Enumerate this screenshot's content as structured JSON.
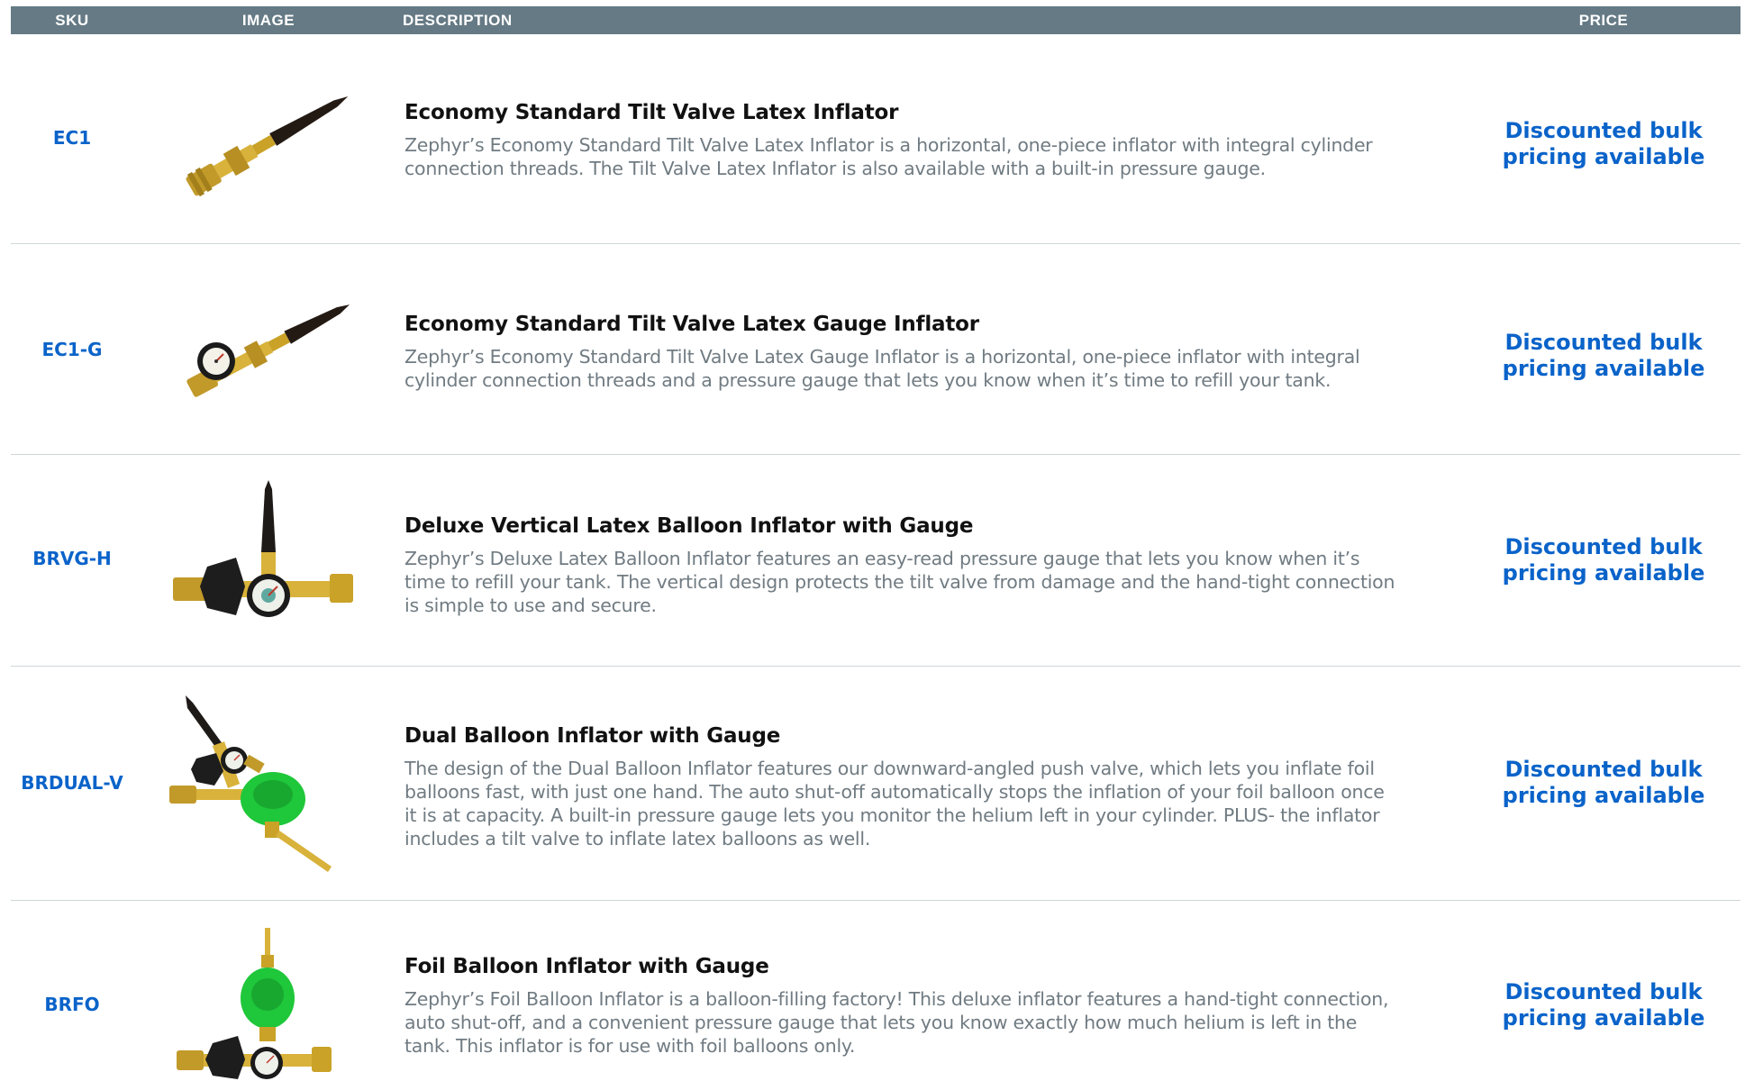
{
  "header": {
    "sku": "SKU",
    "image": "IMAGE",
    "description": "DESCRIPTION",
    "price": "PRICE"
  },
  "colors": {
    "header_bg": "#657a85",
    "accent": "#0a63c9",
    "brass": "#c9a227",
    "green": "#1fc73a"
  },
  "products": [
    {
      "sku": "EC1",
      "icon": "tilt-valve-inflator-icon",
      "title": "Economy Standard Tilt Valve Latex Inflator",
      "description": "Zephyr’s Economy Standard Tilt Valve Latex Inflator is a horizontal, one-piece inflator with integral cylinder connection threads. The Tilt Valve Latex Inflator is also available with a built-in pressure gauge.",
      "price": "Discounted bulk pricing available"
    },
    {
      "sku": "EC1-G",
      "icon": "gauge-inflator-icon",
      "title": "Economy Standard Tilt Valve Latex Gauge Inflator",
      "description": "Zephyr’s Economy Standard Tilt Valve Latex Gauge Inflator is a horizontal, one-piece inflator with integral cylinder connection threads and a pressure gauge that lets you know when it’s time to refill your tank.",
      "price": "Discounted bulk pricing available"
    },
    {
      "sku": "BRVG-H",
      "icon": "vertical-inflator-icon",
      "title": "Deluxe Vertical Latex Balloon Inflator with Gauge",
      "description": "Zephyr’s Deluxe Latex Balloon Inflator features an easy-read pressure gauge that lets you know when it’s time to refill your tank. The vertical design protects the tilt valve from damage and the hand-tight connection is simple to use and secure.",
      "price": "Discounted bulk pricing available"
    },
    {
      "sku": "BRDUAL-V",
      "icon": "dual-inflator-icon",
      "title": "Dual Balloon Inflator with Gauge",
      "description": "The design of the Dual Balloon Inflator features our downward-angled push valve, which lets you inflate foil balloons fast, with just one hand. The auto shut-off automatically stops the inflation of your foil balloon once it is at capacity. A built-in pressure gauge lets you monitor the helium left in your cylinder. PLUS- the inflator includes a tilt valve to inflate latex balloons as well.",
      "price": "Discounted bulk pricing available"
    },
    {
      "sku": "BRFO",
      "icon": "foil-inflator-icon",
      "title": "Foil Balloon Inflator with Gauge",
      "description": "Zephyr’s Foil Balloon Inflator is a balloon-filling factory! This deluxe inflator features a hand-tight connection, auto shut-off, and a convenient pressure gauge that lets you know exactly how much helium is left in the tank. This inflator is for use with foil balloons only.",
      "price": "Discounted bulk pricing available"
    }
  ]
}
